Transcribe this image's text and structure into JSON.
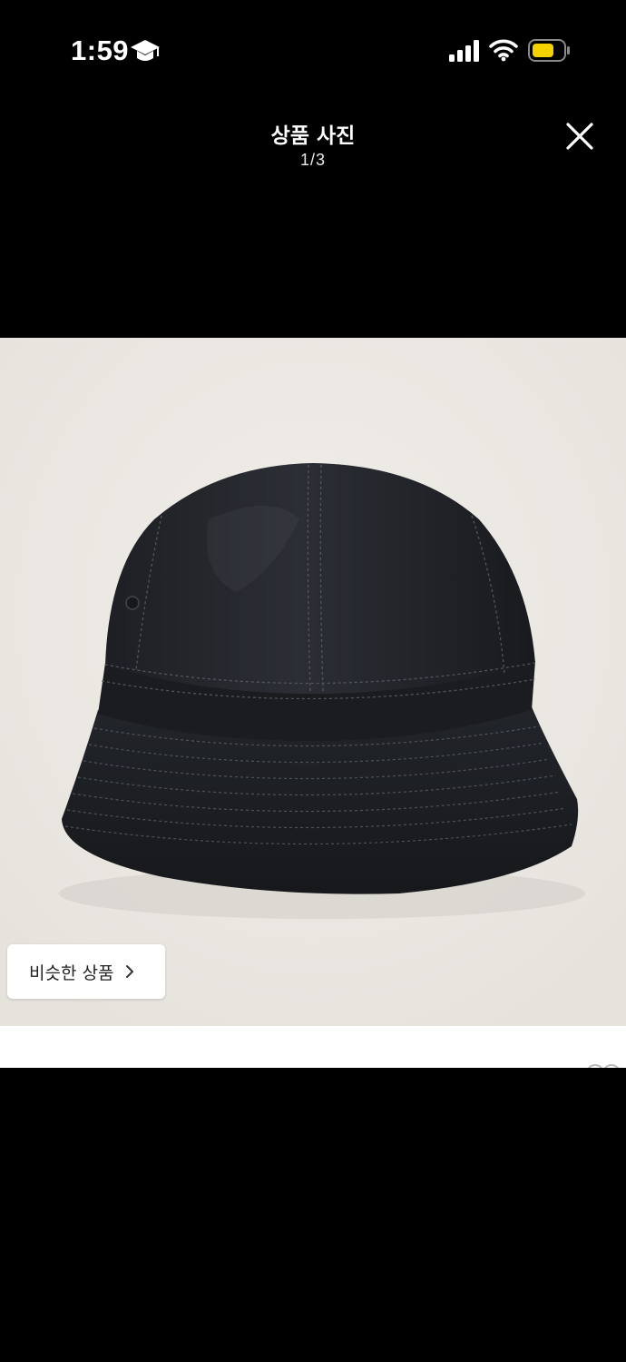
{
  "status": {
    "time": "1:59",
    "time_icon": "graduation-cap-icon",
    "battery_color": "#f5d100"
  },
  "header": {
    "title": "상품 사진",
    "counter": "1/3",
    "close_icon": "close-icon"
  },
  "photo": {
    "alt": "black bucket hat",
    "background": "#ece9e4"
  },
  "similar": {
    "label": "비슷한 상품",
    "icon": "chevron-right-icon"
  }
}
